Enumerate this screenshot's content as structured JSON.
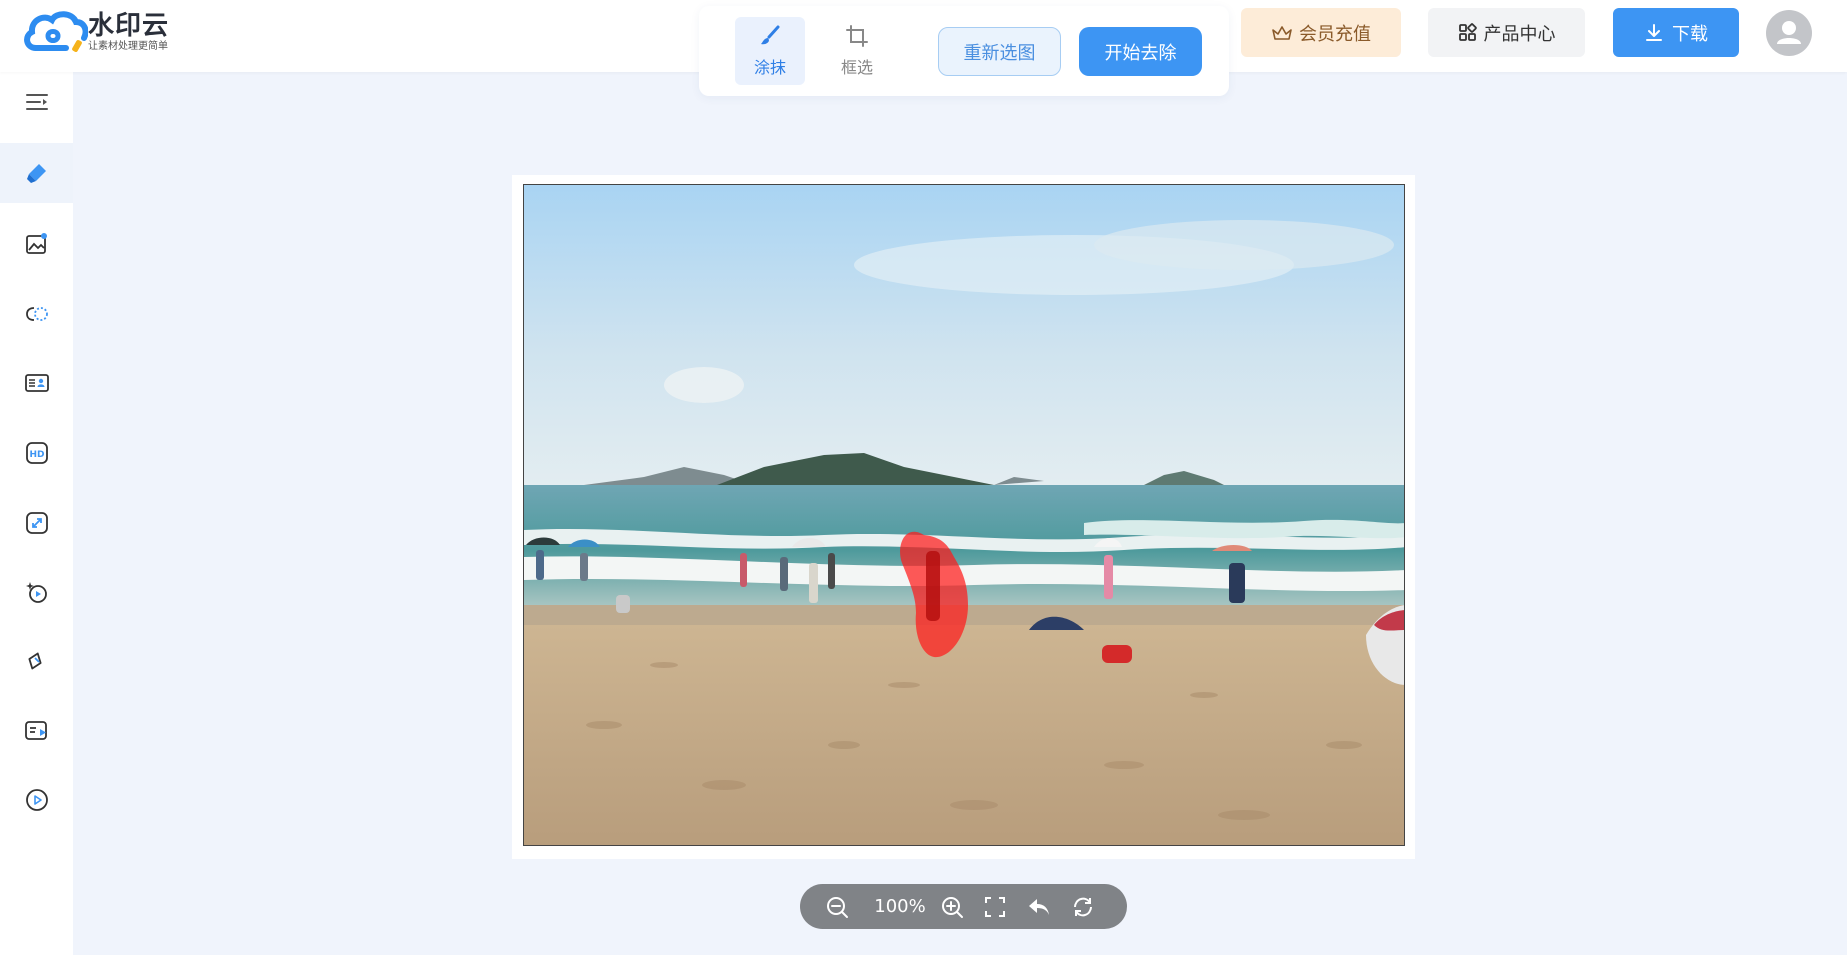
{
  "brand": {
    "name": "水印云",
    "slogan": "让素材处理更简单"
  },
  "toolbar": {
    "tools": [
      {
        "label": "涂抹",
        "icon": "brush-icon",
        "active": true
      },
      {
        "label": "框选",
        "icon": "crop-icon",
        "active": false
      }
    ],
    "reselect_label": "重新选图",
    "start_label": "开始去除"
  },
  "header_actions": {
    "vip_label": "会员充值",
    "products_label": "产品中心",
    "download_label": "下载"
  },
  "sidebar": {
    "items": [
      {
        "icon": "menu-collapse-icon"
      },
      {
        "icon": "eraser-icon",
        "active": true
      },
      {
        "icon": "image-edit-icon"
      },
      {
        "icon": "cutout-icon"
      },
      {
        "icon": "id-photo-icon"
      },
      {
        "icon": "hd-icon"
      },
      {
        "icon": "resize-icon"
      },
      {
        "icon": "ai-video-icon"
      },
      {
        "icon": "link-icon"
      },
      {
        "icon": "video-text-icon"
      },
      {
        "icon": "play-icon"
      }
    ]
  },
  "zoom": {
    "value": "100%"
  },
  "colors": {
    "accent": "#3d95f3",
    "accent_light": "#eaf3fd",
    "vip_bg": "#fdecd8",
    "background": "#f0f4fc",
    "mask": "#ff1a1a"
  }
}
